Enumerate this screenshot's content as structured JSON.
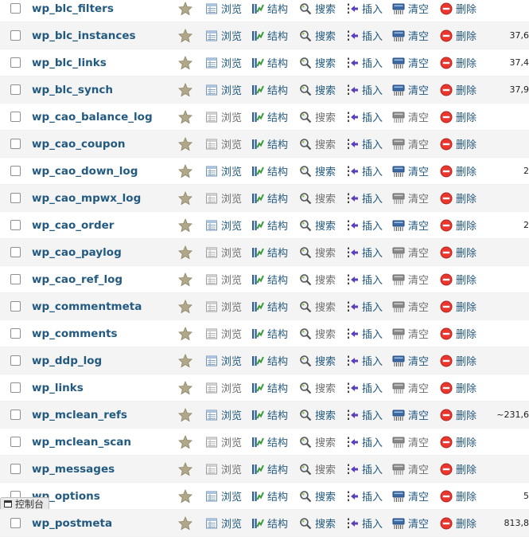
{
  "actions": {
    "browse": "浏览",
    "structure": "结构",
    "search": "搜索",
    "insert": "插入",
    "empty": "清空",
    "drop": "删除"
  },
  "icons": {
    "favorite": "star-icon",
    "browse": "browse-icon",
    "structure": "structure-icon",
    "search": "search-icon",
    "insert": "insert-icon",
    "empty": "empty-icon",
    "drop": "drop-icon"
  },
  "colors": {
    "link": "#235a81",
    "drop_red": "#e8372e",
    "star": "#a59c7c",
    "row_alt": "#f4f4f4"
  },
  "tables": [
    {
      "name": "wp_blc_filters",
      "rows": "",
      "empty": false
    },
    {
      "name": "wp_blc_instances",
      "rows": "37,6",
      "empty": false
    },
    {
      "name": "wp_blc_links",
      "rows": "37,4",
      "empty": false
    },
    {
      "name": "wp_blc_synch",
      "rows": "37,9",
      "empty": false
    },
    {
      "name": "wp_cao_balance_log",
      "rows": "",
      "empty": true
    },
    {
      "name": "wp_cao_coupon",
      "rows": "",
      "empty": true
    },
    {
      "name": "wp_cao_down_log",
      "rows": "2",
      "empty": false
    },
    {
      "name": "wp_cao_mpwx_log",
      "rows": "",
      "empty": true
    },
    {
      "name": "wp_cao_order",
      "rows": "2",
      "empty": false
    },
    {
      "name": "wp_cao_paylog",
      "rows": "",
      "empty": true
    },
    {
      "name": "wp_cao_ref_log",
      "rows": "",
      "empty": true
    },
    {
      "name": "wp_commentmeta",
      "rows": "",
      "empty": true
    },
    {
      "name": "wp_comments",
      "rows": "",
      "empty": true
    },
    {
      "name": "wp_ddp_log",
      "rows": "",
      "empty": false
    },
    {
      "name": "wp_links",
      "rows": "",
      "empty": true
    },
    {
      "name": "wp_mclean_refs",
      "rows": "~231,6",
      "empty": false
    },
    {
      "name": "wp_mclean_scan",
      "rows": "",
      "empty": true
    },
    {
      "name": "wp_messages",
      "rows": "",
      "empty": true
    },
    {
      "name": "wp_options",
      "rows": "5",
      "empty": false
    },
    {
      "name": "wp_postmeta",
      "rows": "813,8",
      "empty": false
    }
  ],
  "console": {
    "label": "控制台"
  }
}
